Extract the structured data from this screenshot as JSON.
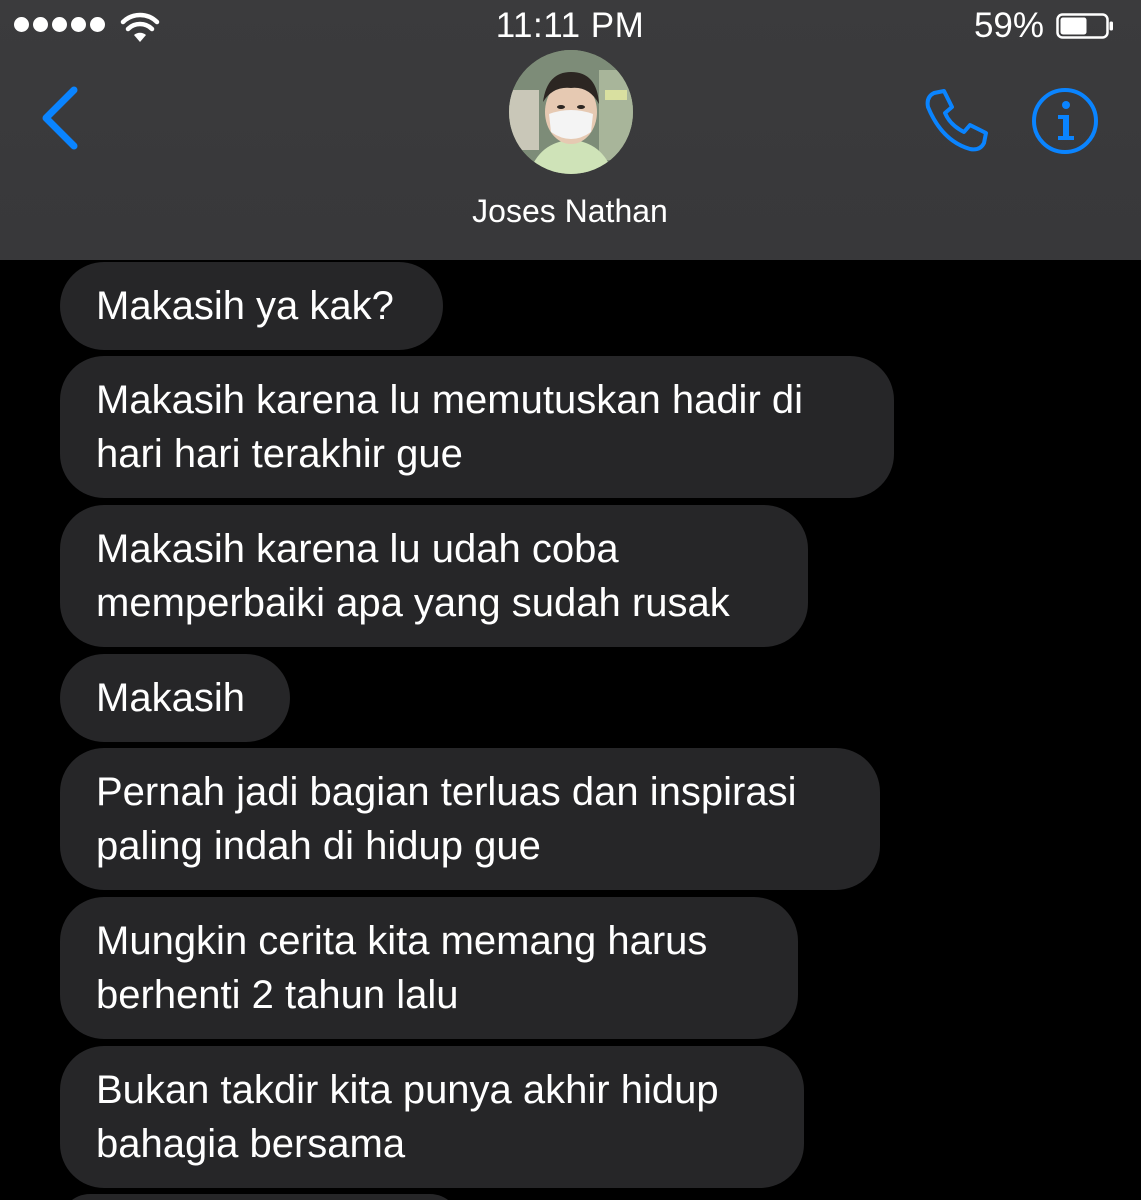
{
  "status_bar": {
    "time": "11:11 PM",
    "battery_percent": "59%",
    "battery_level": 0.59,
    "signal_bars": 5
  },
  "header": {
    "contact_name": "Joses Nathan",
    "back_icon": "chevron-left-icon",
    "call_icon": "phone-icon",
    "info_icon": "info-icon"
  },
  "colors": {
    "accent": "#0a84ff",
    "header_bg": "#3a3a3c",
    "bubble_bg": "#262628",
    "thread_bg": "#000000"
  },
  "messages": [
    {
      "text": "Makasih ya kak?"
    },
    {
      "text": "Makasih karena lu memutuskan hadir di\nhari hari terakhir gue"
    },
    {
      "text": "Makasih karena lu udah coba\nmemperbaiki apa yang sudah rusak"
    },
    {
      "text": "Makasih"
    },
    {
      "text": "Pernah jadi bagian terluas dan inspirasi\npaling indah di hidup gue"
    },
    {
      "text": "Mungkin cerita kita memang harus\nberhenti 2 tahun lalu"
    },
    {
      "text": "Bukan takdir kita punya akhir hidup\nbahagia bersama"
    }
  ]
}
